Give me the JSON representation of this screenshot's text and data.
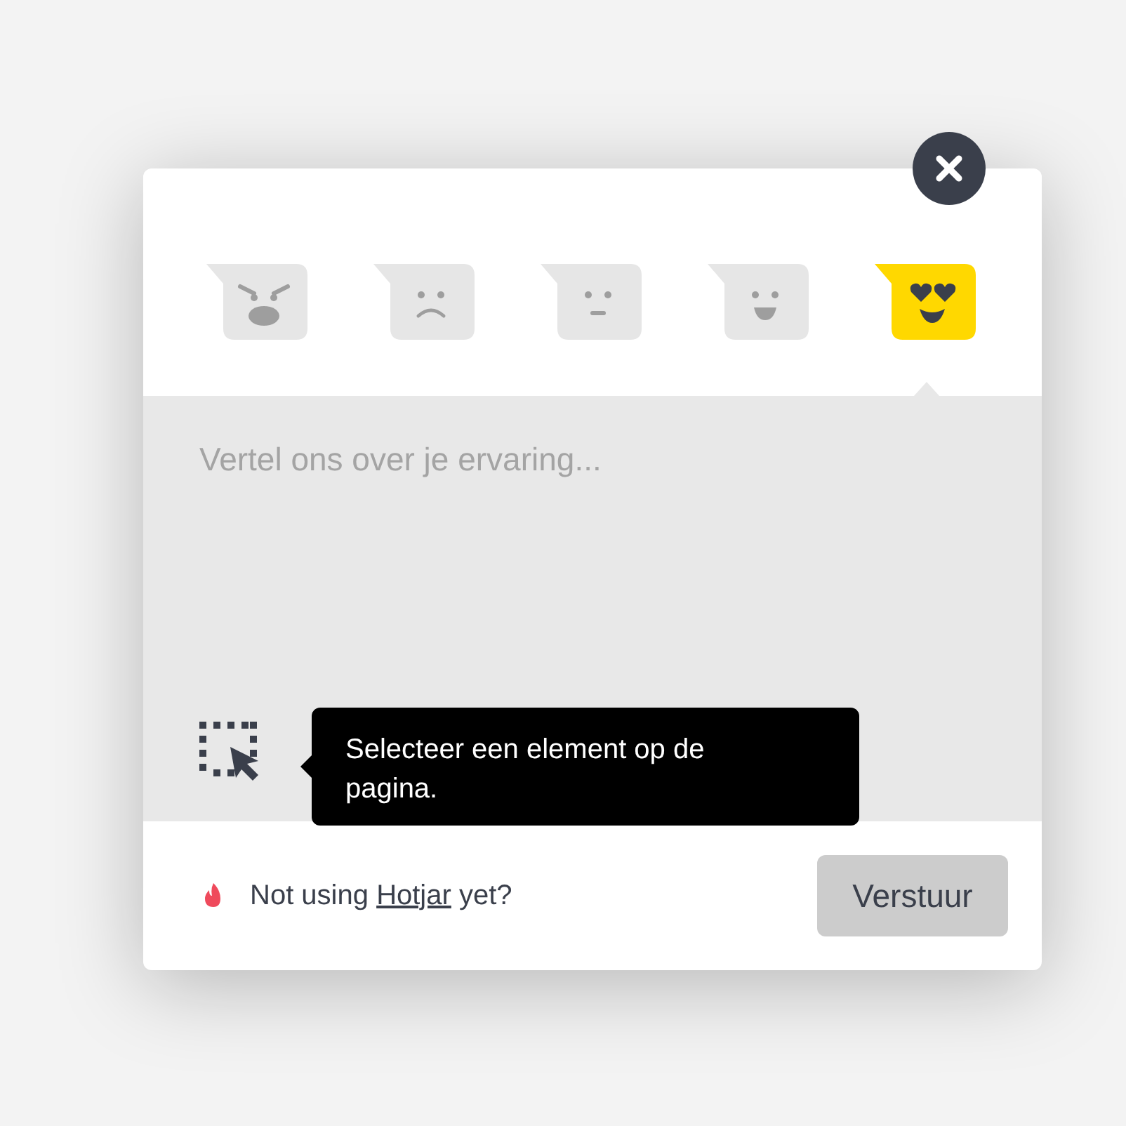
{
  "ratings": [
    {
      "kind": "angry",
      "selected": false
    },
    {
      "kind": "sad",
      "selected": false
    },
    {
      "kind": "neutral",
      "selected": false
    },
    {
      "kind": "happy",
      "selected": false
    },
    {
      "kind": "love",
      "selected": true
    }
  ],
  "comment": {
    "placeholder": "Vertel ons over je ervaring..."
  },
  "tooltip": "Selecteer een element op de pagina.",
  "footer": {
    "before": "Not using",
    "link": "Hotjar",
    "after": "yet?"
  },
  "submit": "Verstuur"
}
